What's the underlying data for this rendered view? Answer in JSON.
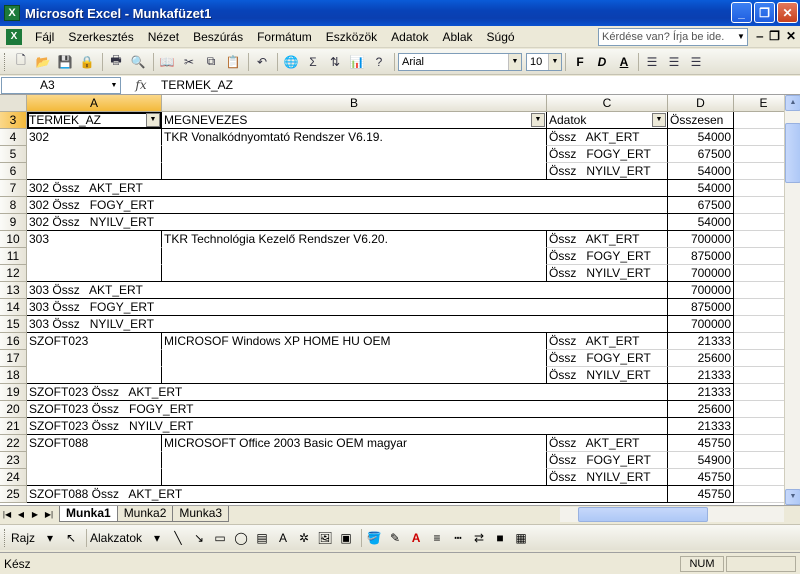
{
  "window": {
    "title": "Microsoft Excel - Munkafüzet1",
    "app_icon": "excel-icon"
  },
  "menu": {
    "items": [
      "Fájl",
      "Szerkesztés",
      "Nézet",
      "Beszúrás",
      "Formátum",
      "Eszközök",
      "Adatok",
      "Ablak",
      "Súgó"
    ],
    "help_placeholder": "Kérdése van? Írja be ide."
  },
  "toolbar": {
    "font_name": "Arial",
    "font_size": "10",
    "bold": "F",
    "italic": "D",
    "underline": "A",
    "sigma": "Σ"
  },
  "formula_bar": {
    "name_box": "A3",
    "fx": "fx",
    "content": "TERMEK_AZ"
  },
  "columns": [
    {
      "letter": "A"
    },
    {
      "letter": "B"
    },
    {
      "letter": "C"
    },
    {
      "letter": "D"
    },
    {
      "letter": "E"
    }
  ],
  "header_row": {
    "row": "3",
    "termek_az": "TERMEK_AZ",
    "megnevezes": "MEGNEVEZES",
    "adatok": "Adatok",
    "osszesen": "Összesen"
  },
  "rows": [
    {
      "row": "4",
      "a": "302",
      "b": "TKR Vonalkódnyomtató Rendszer V6.19.",
      "c": "Össz   AKT_ERT",
      "d": "54000",
      "type": "item-start"
    },
    {
      "row": "5",
      "a": "",
      "b": "",
      "c": "Össz   FOGY_ERT",
      "d": "67500",
      "type": "item"
    },
    {
      "row": "6",
      "a": "",
      "b": "",
      "c": "Össz   NYILV_ERT",
      "d": "54000",
      "type": "item"
    },
    {
      "row": "7",
      "a": "302 Össz   AKT_ERT",
      "b": "",
      "c": "",
      "d": "54000",
      "type": "total"
    },
    {
      "row": "8",
      "a": "302 Össz   FOGY_ERT",
      "b": "",
      "c": "",
      "d": "67500",
      "type": "total"
    },
    {
      "row": "9",
      "a": "302 Össz   NYILV_ERT",
      "b": "",
      "c": "",
      "d": "54000",
      "type": "total"
    },
    {
      "row": "10",
      "a": "303",
      "b": "TKR Technológia Kezelő Rendszer V6.20.",
      "c": "Össz   AKT_ERT",
      "d": "700000",
      "type": "item-start"
    },
    {
      "row": "11",
      "a": "",
      "b": "",
      "c": "Össz   FOGY_ERT",
      "d": "875000",
      "type": "item"
    },
    {
      "row": "12",
      "a": "",
      "b": "",
      "c": "Össz   NYILV_ERT",
      "d": "700000",
      "type": "item"
    },
    {
      "row": "13",
      "a": "303 Össz   AKT_ERT",
      "b": "",
      "c": "",
      "d": "700000",
      "type": "total"
    },
    {
      "row": "14",
      "a": "303 Össz   FOGY_ERT",
      "b": "",
      "c": "",
      "d": "875000",
      "type": "total"
    },
    {
      "row": "15",
      "a": "303 Össz   NYILV_ERT",
      "b": "",
      "c": "",
      "d": "700000",
      "type": "total"
    },
    {
      "row": "16",
      "a": "SZOFT023",
      "b": "MICROSOF Windows XP HOME HU OEM",
      "c": "Össz   AKT_ERT",
      "d": "21333",
      "type": "item-start"
    },
    {
      "row": "17",
      "a": "",
      "b": "",
      "c": "Össz   FOGY_ERT",
      "d": "25600",
      "type": "item"
    },
    {
      "row": "18",
      "a": "",
      "b": "",
      "c": "Össz   NYILV_ERT",
      "d": "21333",
      "type": "item"
    },
    {
      "row": "19",
      "a": "SZOFT023 Össz   AKT_ERT",
      "b": "",
      "c": "",
      "d": "21333",
      "type": "total"
    },
    {
      "row": "20",
      "a": "SZOFT023 Össz   FOGY_ERT",
      "b": "",
      "c": "",
      "d": "25600",
      "type": "total"
    },
    {
      "row": "21",
      "a": "SZOFT023 Össz   NYILV_ERT",
      "b": "",
      "c": "",
      "d": "21333",
      "type": "total"
    },
    {
      "row": "22",
      "a": "SZOFT088",
      "b": "MICROSOFT Office 2003 Basic OEM magyar",
      "c": "Össz   AKT_ERT",
      "d": "45750",
      "type": "item-start"
    },
    {
      "row": "23",
      "a": "",
      "b": "",
      "c": "Össz   FOGY_ERT",
      "d": "54900",
      "type": "item"
    },
    {
      "row": "24",
      "a": "",
      "b": "",
      "c": "Össz   NYILV_ERT",
      "d": "45750",
      "type": "item"
    },
    {
      "row": "25",
      "a": "SZOFT088 Össz   AKT_ERT",
      "b": "",
      "c": "",
      "d": "45750",
      "type": "total"
    }
  ],
  "sheets": [
    "Munka1",
    "Munka2",
    "Munka3"
  ],
  "drawing": {
    "draw_label": "Rajz",
    "autoshapes_label": "Alakzatok"
  },
  "status": {
    "left": "Kész",
    "num": "NUM"
  }
}
